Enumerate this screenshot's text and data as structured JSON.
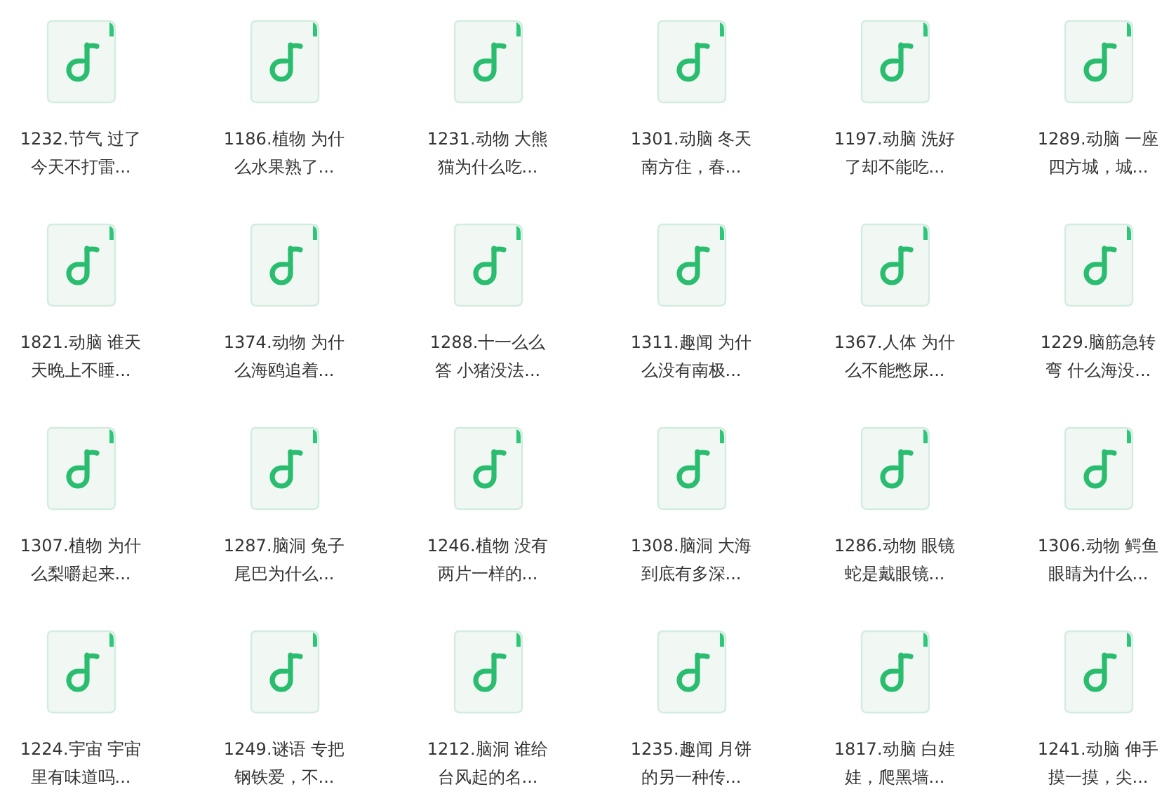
{
  "files": [
    {
      "lines": [
        "1232.节气 过了",
        "今天不打雷..."
      ]
    },
    {
      "lines": [
        "1186.植物 为什",
        "么水果熟了..."
      ]
    },
    {
      "lines": [
        "1231.动物 大熊",
        "猫为什么吃..."
      ]
    },
    {
      "lines": [
        "1301.动脑 冬天",
        "南方住，春..."
      ]
    },
    {
      "lines": [
        "1197.动脑 洗好",
        "了却不能吃..."
      ]
    },
    {
      "lines": [
        "1289.动脑 一座",
        "四方城，城..."
      ]
    },
    {
      "lines": [
        "1821.动脑 谁天",
        "天晚上不睡..."
      ]
    },
    {
      "lines": [
        "1374.动物 为什",
        "么海鸥追着..."
      ]
    },
    {
      "lines": [
        "1288.十一么么",
        "答 小猪没法..."
      ]
    },
    {
      "lines": [
        "1311.趣闻 为什",
        "么没有南极..."
      ]
    },
    {
      "lines": [
        "1367.人体 为什",
        "么不能憋尿..."
      ]
    },
    {
      "lines": [
        "1229.脑筋急转",
        "弯 什么海没..."
      ]
    },
    {
      "lines": [
        "1307.植物 为什",
        "么梨嚼起来..."
      ]
    },
    {
      "lines": [
        "1287.脑洞 兔子",
        "尾巴为什么..."
      ]
    },
    {
      "lines": [
        "1246.植物 没有",
        "两片一样的..."
      ]
    },
    {
      "lines": [
        "1308.脑洞 大海",
        "到底有多深..."
      ]
    },
    {
      "lines": [
        "1286.动物 眼镜",
        "蛇是戴眼镜..."
      ]
    },
    {
      "lines": [
        "1306.动物 鳄鱼",
        "眼睛为什么..."
      ]
    },
    {
      "lines": [
        "1224.宇宙 宇宙",
        "里有味道吗..."
      ]
    },
    {
      "lines": [
        "1249.谜语 专把",
        "钢铁爱，不..."
      ]
    },
    {
      "lines": [
        "1212.脑洞 谁给",
        "台风起的名..."
      ]
    },
    {
      "lines": [
        "1235.趣闻 月饼",
        "的另一种传..."
      ]
    },
    {
      "lines": [
        "1817.动脑 白娃",
        "娃，爬黑墙..."
      ]
    },
    {
      "lines": [
        "1241.动脑 伸手",
        "摸一摸，尖..."
      ]
    }
  ]
}
